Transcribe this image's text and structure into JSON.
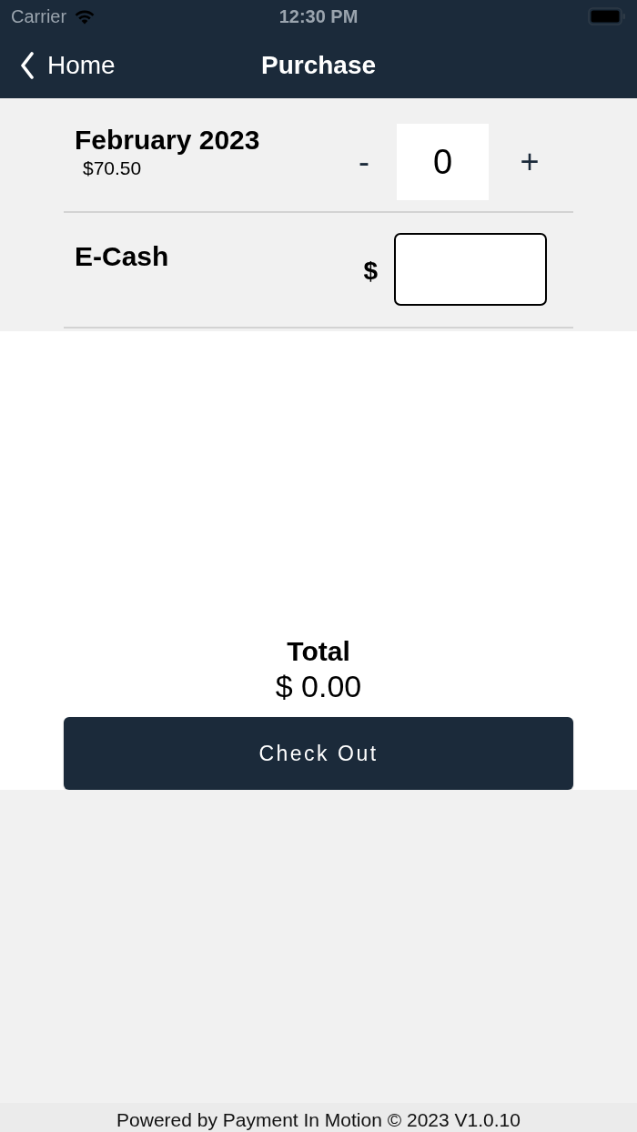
{
  "status_bar": {
    "carrier": "Carrier",
    "time": "12:30 PM"
  },
  "nav": {
    "back": "Home",
    "title": "Purchase"
  },
  "items": [
    {
      "kind": "quantity",
      "name": "February 2023",
      "price": "$70.50",
      "minus": "-",
      "quantity": "0",
      "plus": "+"
    },
    {
      "kind": "amount",
      "name": "E-Cash",
      "currency": "$"
    }
  ],
  "total": {
    "label": "Total",
    "amount": "$ 0.00"
  },
  "checkout_button": "Check Out",
  "footer": "Powered by Payment In Motion © 2023 V1.0.10"
}
